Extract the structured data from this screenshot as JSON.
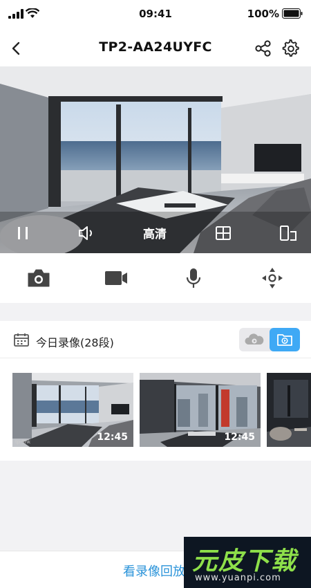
{
  "status": {
    "time": "09:41",
    "battery": "100%"
  },
  "nav": {
    "title": "TP2-AA24UYFC"
  },
  "video": {
    "quality_label": "高清"
  },
  "recordings": {
    "title": "今日录像(28段)",
    "clips": [
      {
        "duration": "12:45"
      },
      {
        "duration": "12:45"
      },
      {
        "duration": ""
      }
    ]
  },
  "footer": {
    "playback_label": "看录像回放"
  },
  "watermark": {
    "text": "元皮下载",
    "url": "www.yuanpi.com"
  },
  "colors": {
    "accent": "#3fa9f5",
    "link": "#2a93d9",
    "icon": "#444444"
  }
}
